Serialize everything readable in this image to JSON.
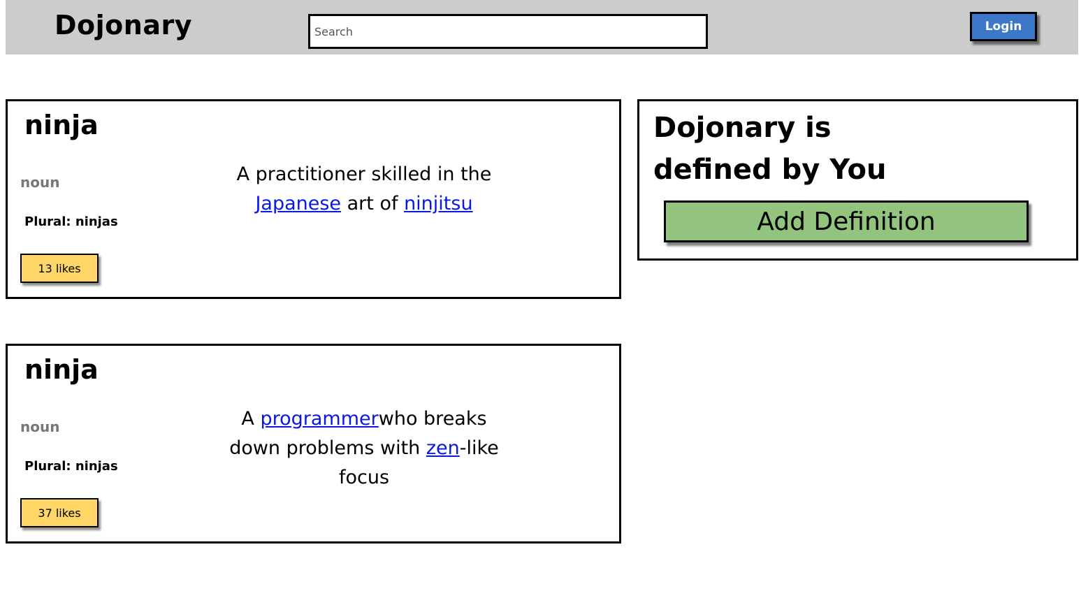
{
  "header": {
    "logo": "Dojonary",
    "search_placeholder": "Search",
    "login_label": "Login"
  },
  "entries": [
    {
      "word": "ninja",
      "part_of_speech": "noun",
      "plural": "Plural: ninjas",
      "likes": "13 likes",
      "definition": {
        "t1": "A practitioner skilled in the ",
        "link1": "Japanese",
        "t2": " art of ",
        "link2": "ninjitsu",
        "t3": ""
      }
    },
    {
      "word": "ninja",
      "part_of_speech": "noun",
      "plural": "Plural: ninjas",
      "likes": "37 likes",
      "definition": {
        "t1": "A ",
        "link1": "programmer",
        "t2": "who breaks down problems with ",
        "link2": "zen",
        "t3": "-like focus"
      }
    }
  ],
  "sidebar": {
    "tagline_line1": "Dojonary is",
    "tagline_line2": "defined by You",
    "add_button_label": "Add Definition"
  }
}
